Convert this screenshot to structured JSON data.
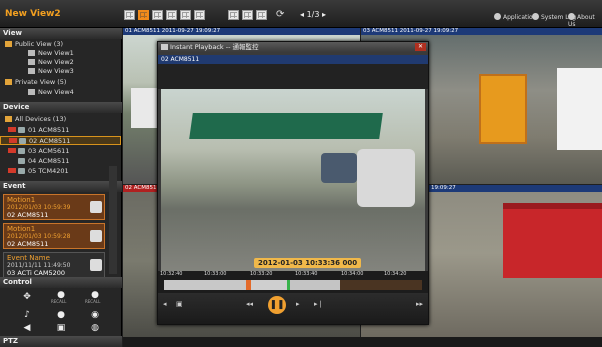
{
  "app": {
    "title": "New View2"
  },
  "top": {
    "pager": "1/3",
    "links": [
      "Application",
      "System Log",
      "About Us"
    ]
  },
  "left": {
    "view_header": "View",
    "view_tree": [
      {
        "label": "Public View (3)",
        "type": "folder"
      },
      {
        "label": "New View1",
        "type": "view"
      },
      {
        "label": "New View2",
        "type": "view"
      },
      {
        "label": "New View3",
        "type": "view"
      },
      {
        "label": "Private View (5)",
        "type": "folder"
      },
      {
        "label": "New View4",
        "type": "view"
      }
    ],
    "device_header": "Device",
    "device_tree": [
      {
        "label": "All Devices (13)",
        "type": "folder"
      },
      {
        "label": "01  ACM8511",
        "type": "cam"
      },
      {
        "label": "02  ACM8511",
        "type": "cam",
        "selected": true
      },
      {
        "label": "03  ACM5611",
        "type": "cam"
      },
      {
        "label": "04  ACM8511",
        "type": "cam"
      },
      {
        "label": "05  TCM4201",
        "type": "cam"
      }
    ],
    "event_header": "Event",
    "events": [
      {
        "name": "Motion1",
        "time": "2012/01/03 10:59:39",
        "device": "02 ACM8511"
      },
      {
        "name": "Motion1",
        "time": "2012/01/03 10:59:28",
        "device": "02 ACM8511"
      },
      {
        "name": "Event Name",
        "time": "2011/11/11 11:49:50",
        "device": "03 ACTi CAM5200"
      }
    ],
    "control_header": "Control",
    "control_captions": [
      "RECALL",
      "RECALL"
    ],
    "ptz_header": "PTZ"
  },
  "tiles": [
    {
      "title": "01 ACM8511  2011-09-27  19:09:27"
    },
    {
      "title": "03 ACM8511  2011-09-27  19:09:27"
    },
    {
      "title": "02 ACM8511"
    },
    {
      "title": "19:09:27"
    }
  ],
  "playback": {
    "title": "Instant Playback -- 通報監控",
    "camera": "02 ACM8511",
    "timestamp": "2012-01-03 10:33:36 000",
    "ticks": [
      "10:32:40",
      "10:33:00",
      "10:33:20",
      "10:33:40",
      "10:34:00",
      "10:34:20"
    ]
  },
  "colors": {
    "accent": "#f08a1a",
    "title_bar": "#1d3a78",
    "alarm_bar": "#b02020"
  }
}
